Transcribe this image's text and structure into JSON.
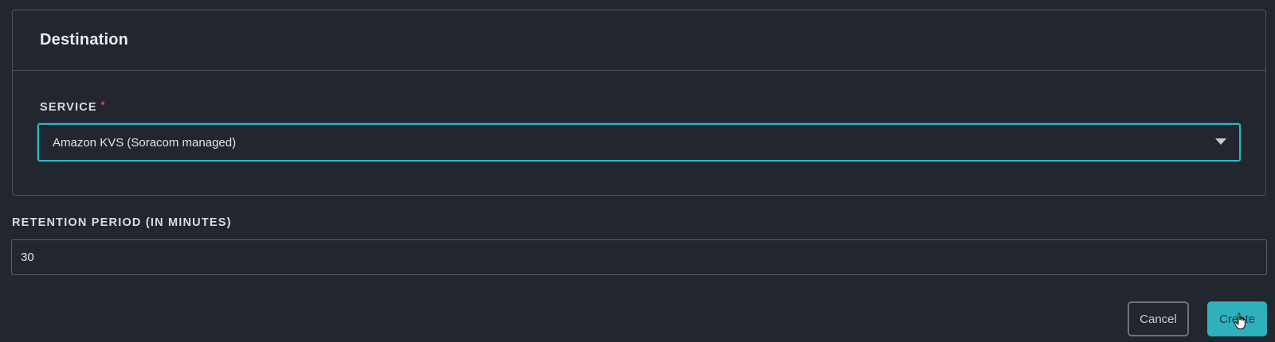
{
  "destination": {
    "title": "Destination",
    "service": {
      "label": "SERVICE",
      "required_mark": "*",
      "selected_value": "Amazon KVS (Soracom managed)"
    }
  },
  "retention": {
    "label": "RETENTION PERIOD (IN MINUTES)",
    "value": "30"
  },
  "actions": {
    "cancel_label": "Cancel",
    "create_label": "Create"
  },
  "icons": {
    "select_caret": "chevron-down-icon",
    "pointer": "hand-pointer-icon"
  },
  "colors": {
    "background": "#22262e",
    "accent": "#2fb1bc",
    "required": "#e0524a",
    "border": "#4b525c"
  }
}
